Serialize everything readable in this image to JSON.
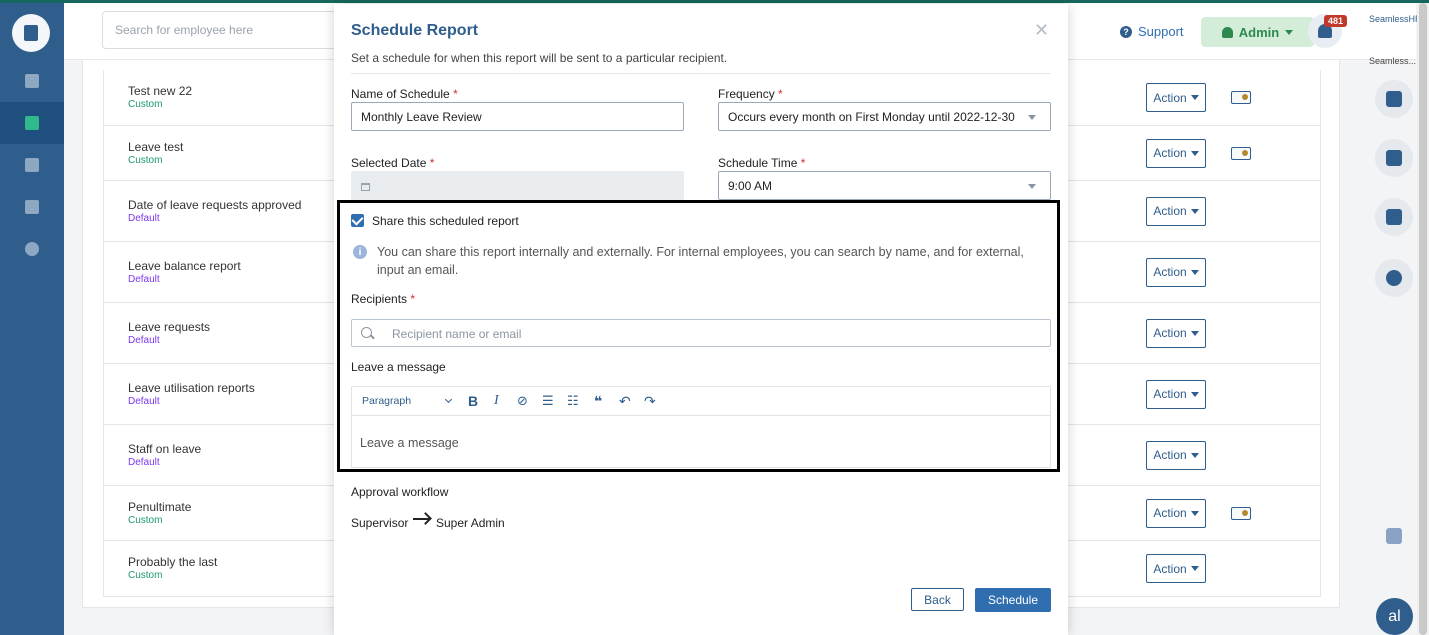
{
  "header": {
    "search_placeholder": "Search for employee here",
    "support_label": "Support",
    "admin_label": "Admin",
    "notification_count": "481",
    "brand": "SeamlessHR"
  },
  "right_rail": {
    "label": "Seamless...",
    "avatar_initials": "al"
  },
  "reports": [
    {
      "name": "Test new 22",
      "type": "Custom",
      "action": "Action"
    },
    {
      "name": "Leave test",
      "type": "Custom",
      "action": "Action"
    },
    {
      "name": "Date of leave requests approved",
      "type": "Default",
      "action": "Action"
    },
    {
      "name": "Leave balance report",
      "type": "Default",
      "action": "Action"
    },
    {
      "name": "Leave requests",
      "type": "Default",
      "action": "Action"
    },
    {
      "name": "Leave utilisation reports",
      "type": "Default",
      "action": "Action"
    },
    {
      "name": "Staff on leave",
      "type": "Default",
      "action": "Action"
    },
    {
      "name": "Penultimate",
      "type": "Custom",
      "action": "Action"
    },
    {
      "name": "Probably the last",
      "type": "Custom",
      "action": "Action"
    }
  ],
  "modal": {
    "title": "Schedule Report",
    "subtitle": "Set a schedule for when this report will be sent to a particular recipient.",
    "name_label": "Name of Schedule",
    "name_value": "Monthly Leave Review",
    "frequency_label": "Frequency",
    "frequency_value": "Occurs every month on First Monday until 2022-12-30",
    "date_label": "Selected Date",
    "time_label": "Schedule Time",
    "time_value": "9:00 AM",
    "share_label": "Share this scheduled report",
    "info_text": "You can share this report internally and externally. For internal employees, you can search by name, and for external, input an email.",
    "recipients_label": "Recipients",
    "recipients_placeholder": "Recipient name or email",
    "message_label": "Leave a message",
    "paragraph_label": "Paragraph",
    "message_placeholder": "Leave a message",
    "approval_label": "Approval workflow",
    "approval_from": "Supervisor",
    "approval_to": "Super Admin",
    "back_label": "Back",
    "schedule_label": "Schedule",
    "required_mark": "*"
  },
  "colors": {
    "primary": "#2f5d8c",
    "accent_button": "#2f6fb0",
    "custom_tag": "#1e9a6c",
    "default_tag": "#7c3aed",
    "required": "#d32f2f"
  }
}
